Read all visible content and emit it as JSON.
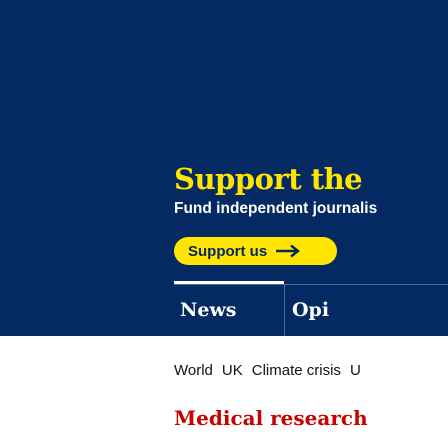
{
  "support_banner": {
    "title": "Support the",
    "subtitle": "Fund independent journalis",
    "button_label": "Support us",
    "button_icon": "arrow-right-icon"
  },
  "nav": {
    "pillars": [
      {
        "label": "News"
      },
      {
        "label": "Opi"
      }
    ]
  },
  "subnav": {
    "items": [
      {
        "label": "World"
      },
      {
        "label": "UK"
      },
      {
        "label": "Climate crisis"
      },
      {
        "label": "U"
      }
    ]
  },
  "section": {
    "heading": "Medical research"
  },
  "colors": {
    "header_bg": "#052962",
    "accent_yellow": "#ffe500",
    "section_red": "#c70000"
  }
}
